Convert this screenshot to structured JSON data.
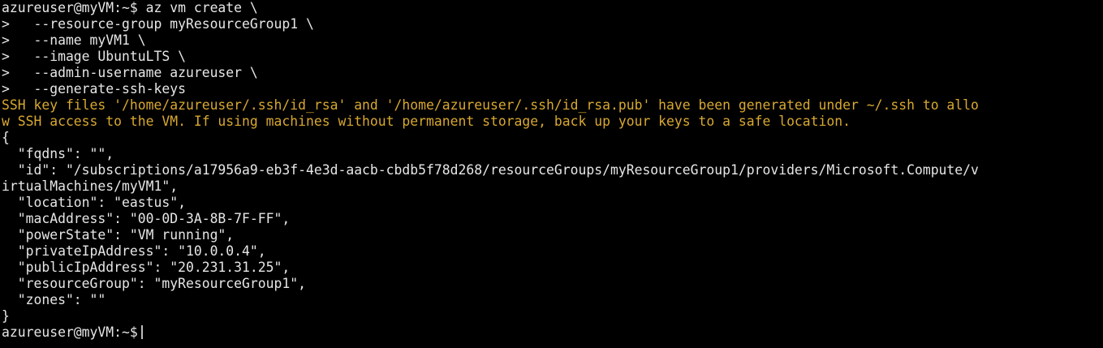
{
  "terminal": {
    "colors": {
      "background": "#000000",
      "text": "#e6e6e6",
      "warning": "#d8a830",
      "cursor": "#bdbdbd"
    },
    "lines": [
      "azureuser@myVM:~$ az vm create \\",
      ">   --resource-group myResourceGroup1 \\",
      ">   --name myVM1 \\",
      ">   --image UbuntuLTS \\",
      ">   --admin-username azureuser \\",
      ">   --generate-ssh-keys",
      "SSH key files '/home/azureuser/.ssh/id_rsa' and '/home/azureuser/.ssh/id_rsa.pub' have been generated under ~/.ssh to allo",
      "w SSH access to the VM. If using machines without permanent storage, back up your keys to a safe location.",
      "{",
      "  \"fqdns\": \"\",",
      "  \"id\": \"/subscriptions/a17956a9-eb3f-4e3d-aacb-cbdb5f78d268/resourceGroups/myResourceGroup1/providers/Microsoft.Compute/v",
      "irtualMachines/myVM1\",",
      "  \"location\": \"eastus\",",
      "  \"macAddress\": \"00-0D-3A-8B-7F-FF\",",
      "  \"powerState\": \"VM running\",",
      "  \"privateIpAddress\": \"10.0.0.4\",",
      "  \"publicIpAddress\": \"20.231.31.25\",",
      "  \"resourceGroup\": \"myResourceGroup1\",",
      "  \"zones\": \"\"",
      "}"
    ],
    "prompt": "azureuser@myVM:~$"
  }
}
